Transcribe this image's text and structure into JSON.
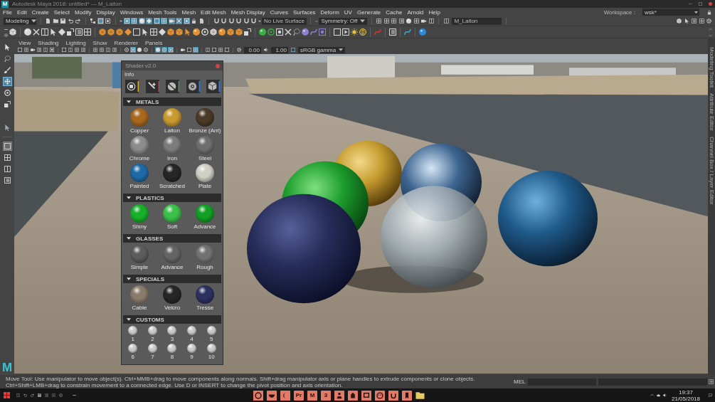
{
  "title_bar": {
    "logo": "M",
    "title": "Autodesk Maya 2018: untitled*   ---   M_Laiton"
  },
  "menu_bar": [
    "File",
    "Edit",
    "Create",
    "Select",
    "Modify",
    "Display",
    "Windows",
    "Mesh Tools",
    "Mesh",
    "Edit Mesh",
    "Mesh Display",
    "Curves",
    "Surfaces",
    "Deform",
    "UV",
    "Generate",
    "Cache",
    "Arnold",
    "Help"
  ],
  "workspace": {
    "label": "Workspace :",
    "value": "wsk*"
  },
  "status_line": {
    "menu_set": "Modeling",
    "selection_modes": [
      {
        "selected": false
      },
      {
        "selected": true
      },
      {
        "selected": false
      }
    ],
    "select_masks": [
      {
        "on": true
      },
      {
        "on": true
      },
      {
        "on": true
      },
      {
        "on": true
      },
      {
        "on": true
      },
      {
        "on": true
      },
      {
        "on": true
      },
      {
        "on": true
      },
      {
        "on": true
      }
    ],
    "snap_toggles": [
      {
        "on": false
      },
      {
        "on": false
      },
      {
        "on": false
      },
      {
        "on": false
      },
      {
        "on": false
      },
      {
        "on": false
      }
    ],
    "live_surface": "No Live Surface",
    "symmetry": "Symmetry: Off",
    "object_name": "M_Laiton"
  },
  "toolbox": {
    "tools": [
      {
        "selected": false
      },
      {
        "selected": false
      },
      {
        "selected": false
      },
      {
        "selected": true
      },
      {
        "selected": false
      },
      {
        "selected": false
      }
    ],
    "layouts": [
      {
        "selected": true
      },
      {
        "selected": false
      },
      {
        "selected": false
      },
      {
        "selected": false
      }
    ],
    "logo": "M"
  },
  "panel_menu": [
    "View",
    "Shading",
    "Lighting",
    "Show",
    "Renderer",
    "Panels"
  ],
  "panel_toolbar": {
    "toggle_groups": [
      [
        {
          "on": false
        },
        {
          "on": false
        },
        {
          "on": false
        },
        {
          "on": false
        },
        {
          "on": false
        },
        {
          "on": false
        }
      ],
      [
        {
          "on": false
        },
        {
          "on": false
        },
        {
          "on": false
        },
        {
          "on": false
        }
      ],
      [
        {
          "on": false
        },
        {
          "on": false
        },
        {
          "on": false
        },
        {
          "on": false
        }
      ],
      [
        {
          "on": false
        },
        {
          "on": true
        },
        {
          "on": false
        },
        {
          "on": false
        }
      ],
      [
        {
          "on": true
        },
        {
          "on": true
        },
        {
          "on": true
        }
      ],
      [
        {
          "on": false
        },
        {
          "on": false
        },
        {
          "on": true
        }
      ],
      [
        {
          "on": false
        },
        {
          "on": false
        },
        {
          "on": false
        },
        {
          "on": false
        }
      ]
    ],
    "exposure": "0.00",
    "gamma": "1.00",
    "view_transform": "sRGB gamma"
  },
  "shader_panel": {
    "title": "Shader v2.0",
    "info_label": "Info",
    "sections": [
      {
        "title": "METALS",
        "kind": "preset",
        "expanded": true,
        "materials": [
          {
            "label": "Copper",
            "color": "#a8681e"
          },
          {
            "label": "Laiton",
            "color": "#c89a30"
          },
          {
            "label": "Bronze (Ant)",
            "color": "#4a3a26"
          },
          {
            "label": "Chrome",
            "color": "#8c8c8c"
          },
          {
            "label": "Iron",
            "color": "#7c7c7c"
          },
          {
            "label": "Steel",
            "color": "#6e6e6e"
          },
          {
            "label": "Painted",
            "color": "#1e6aa6"
          },
          {
            "label": "Scratched",
            "color": "#262626"
          },
          {
            "label": "Plate",
            "color": "#cfcfc4"
          }
        ]
      },
      {
        "title": "PLASTICS",
        "kind": "preset",
        "expanded": true,
        "materials": [
          {
            "label": "Shiny",
            "color": "#18b02a"
          },
          {
            "label": "Soft",
            "color": "#3cc04a"
          },
          {
            "label": "Advance",
            "color": "#12a024"
          }
        ]
      },
      {
        "title": "GLASSES",
        "kind": "preset",
        "expanded": true,
        "materials": [
          {
            "label": "Simple",
            "color": "#5c5c5c"
          },
          {
            "label": "Advance",
            "color": "#646464"
          },
          {
            "label": "Rough",
            "color": "#727272"
          }
        ]
      },
      {
        "title": "SPECIALS",
        "kind": "preset",
        "expanded": true,
        "materials": [
          {
            "label": "Cable",
            "color": "#8a7c6c"
          },
          {
            "label": "Velcro",
            "color": "#262626"
          },
          {
            "label": "Tresse",
            "color": "#2c3160"
          }
        ]
      },
      {
        "title": "CUSTOMS",
        "kind": "custom",
        "expanded": true,
        "materials": [
          {
            "label": "1"
          },
          {
            "label": "2"
          },
          {
            "label": "3"
          },
          {
            "label": "4"
          },
          {
            "label": "5"
          },
          {
            "label": "6"
          },
          {
            "label": "7"
          },
          {
            "label": "8"
          },
          {
            "label": "9"
          },
          {
            "label": "10"
          }
        ]
      }
    ]
  },
  "side_tabs": [
    "Modeling Toolkit",
    "Attribute Editor",
    "Channel Box / Layer Editor"
  ],
  "help_line": "Move Tool: Use manipulator to move object(s). Ctrl+MMB+drag to move components along normals. Shift+drag manipulator axis or plane handles to extrude components or clone objects. Ctrl+Shift+LMB+drag to constrain movement to a connected edge. Use D or INSERT to change the pivot position and axis orientation.",
  "command_line": {
    "language": "MEL"
  },
  "taskbar": {
    "apps": [
      {
        "kind": "icon"
      },
      {
        "kind": "icon"
      },
      {
        "kind": "icon"
      },
      {
        "kind": "letter",
        "label": "Pr"
      },
      {
        "kind": "letter",
        "label": "M"
      },
      {
        "kind": "letter",
        "label": "3"
      },
      {
        "kind": "icon"
      },
      {
        "kind": "icon"
      },
      {
        "kind": "icon"
      },
      {
        "kind": "icon"
      },
      {
        "kind": "icon"
      },
      {
        "kind": "icon"
      },
      {
        "kind": "folder"
      }
    ],
    "time": "19:37",
    "date": "21/05/2018"
  }
}
